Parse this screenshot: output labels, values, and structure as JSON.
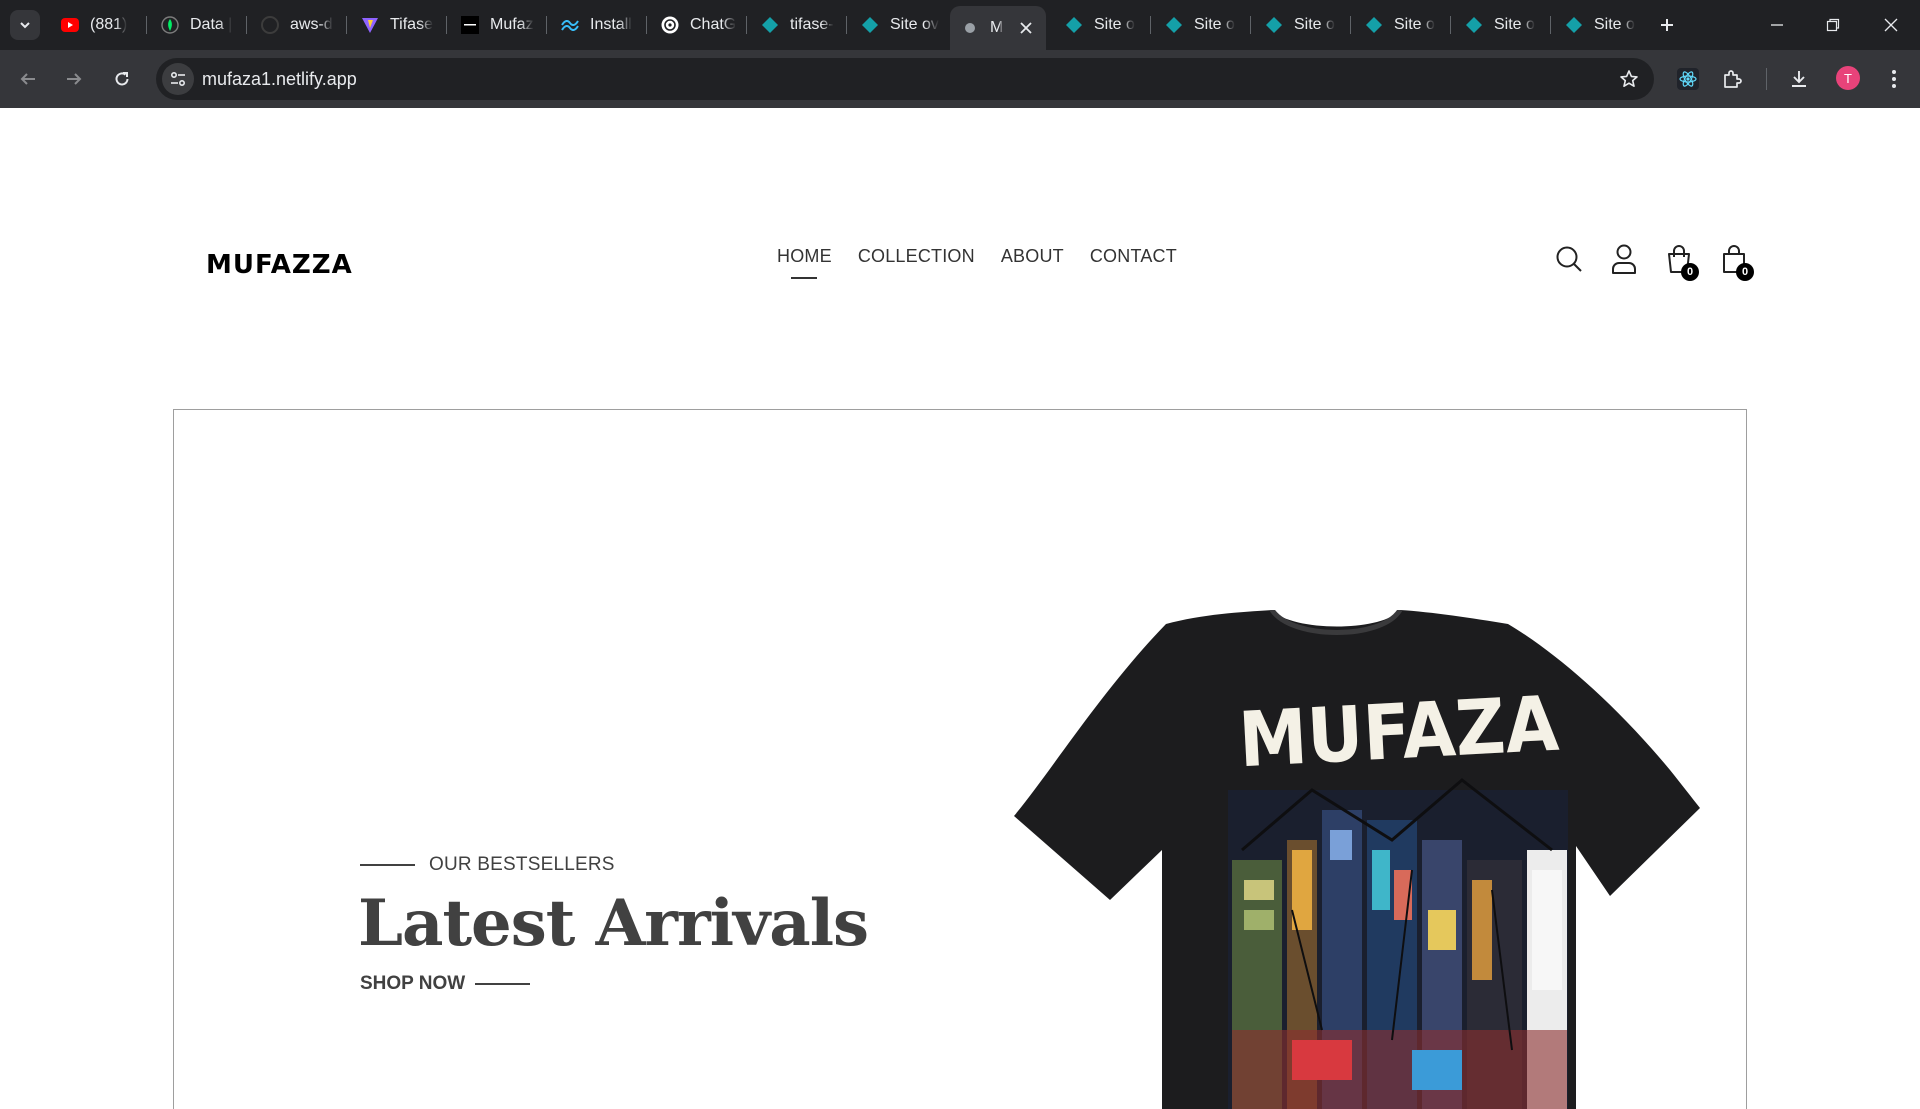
{
  "browser": {
    "tabs": [
      {
        "title": "(881)",
        "icon": "youtube-icon"
      },
      {
        "title": "Data |",
        "icon": "mongodb-leaf-icon"
      },
      {
        "title": "aws-d",
        "icon": "github-icon"
      },
      {
        "title": "Tifase",
        "icon": "vite-icon"
      },
      {
        "title": "Mufaz",
        "icon": "mufaza-favicon-icon"
      },
      {
        "title": "Install",
        "icon": "tailwind-icon"
      },
      {
        "title": "ChatG",
        "icon": "chatgpt-icon"
      },
      {
        "title": "tifase-",
        "icon": "netlify-icon"
      },
      {
        "title": "Site ov",
        "icon": "netlify-icon"
      },
      {
        "title": "M",
        "icon": "loading-icon",
        "active": true
      },
      {
        "title": "Site o",
        "icon": "netlify-icon"
      },
      {
        "title": "Site o",
        "icon": "netlify-icon"
      },
      {
        "title": "Site o",
        "icon": "netlify-icon"
      },
      {
        "title": "Site o",
        "icon": "netlify-icon"
      },
      {
        "title": "Site o",
        "icon": "netlify-icon"
      },
      {
        "title": "Site o",
        "icon": "netlify-icon"
      }
    ],
    "url": "mufaza1.netlify.app",
    "profile_initial": "T"
  },
  "site": {
    "logo": "MUFAZZA",
    "nav": [
      {
        "label": "HOME",
        "active": true
      },
      {
        "label": "COLLECTION"
      },
      {
        "label": "ABOUT"
      },
      {
        "label": "CONTACT"
      }
    ],
    "cart_count": "0",
    "bag_count": "0",
    "hero": {
      "eyebrow": "OUR BESTSELLERS",
      "title": "Latest Arrivals",
      "cta": "SHOP NOW",
      "shirt_print": "MUFAZA"
    }
  },
  "colors": {
    "chrome_dark": "#202124",
    "chrome_toolbar": "#35363a",
    "text": "#414141",
    "netlify": "#14a0a8",
    "avatar": "#e8437a"
  }
}
